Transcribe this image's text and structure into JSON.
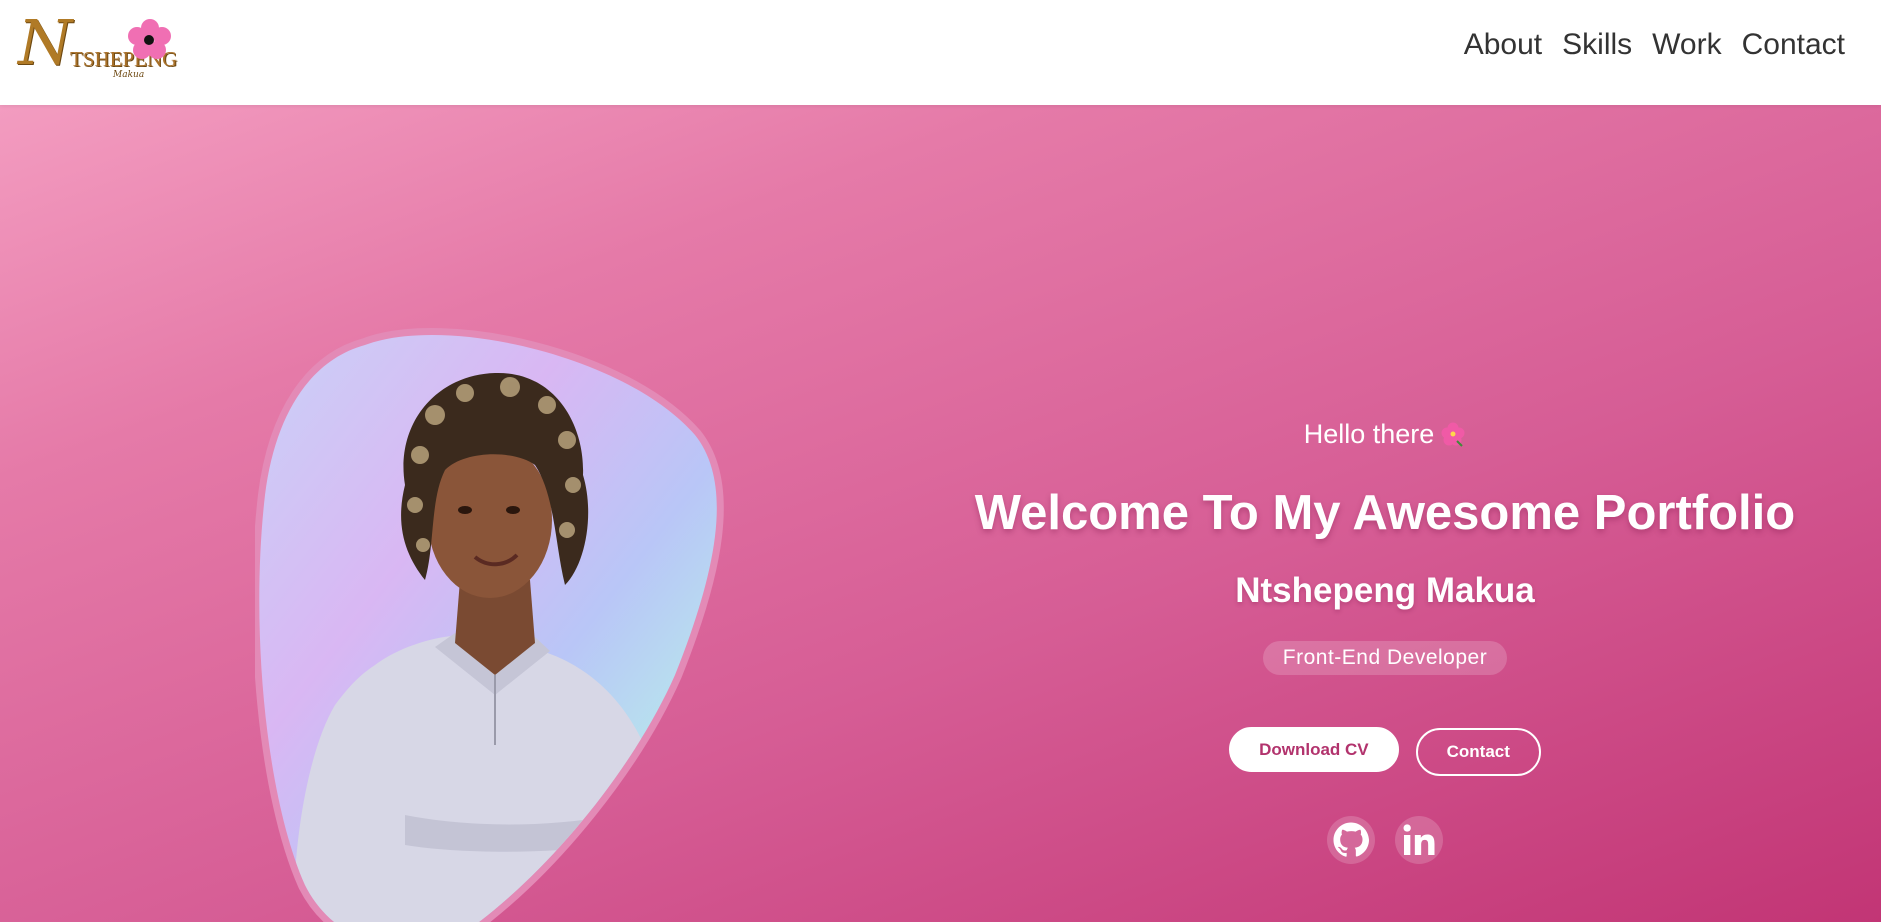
{
  "header": {
    "logo": {
      "script_letter": "N",
      "wordmark": "TSHEPENG",
      "signature": "Makua"
    },
    "nav": [
      {
        "label": "About"
      },
      {
        "label": "Skills"
      },
      {
        "label": "Work"
      },
      {
        "label": "Contact"
      }
    ]
  },
  "hero": {
    "greeting": "Hello there",
    "greeting_icon": "hibiscus-flower-icon",
    "headline": "Welcome To My Awesome Portfolio",
    "name": "Ntshepeng Makua",
    "role": "Front-End Developer",
    "buttons": {
      "download_cv": "Download CV",
      "contact": "Contact"
    },
    "socials": [
      {
        "icon": "github-icon"
      },
      {
        "icon": "linkedin-icon"
      }
    ]
  },
  "colors": {
    "hero_gradient_start": "#f39cc0",
    "hero_gradient_end": "#c23575",
    "accent": "#b2336d",
    "nav_text": "#333333",
    "logo_gold": "#b07a26"
  }
}
